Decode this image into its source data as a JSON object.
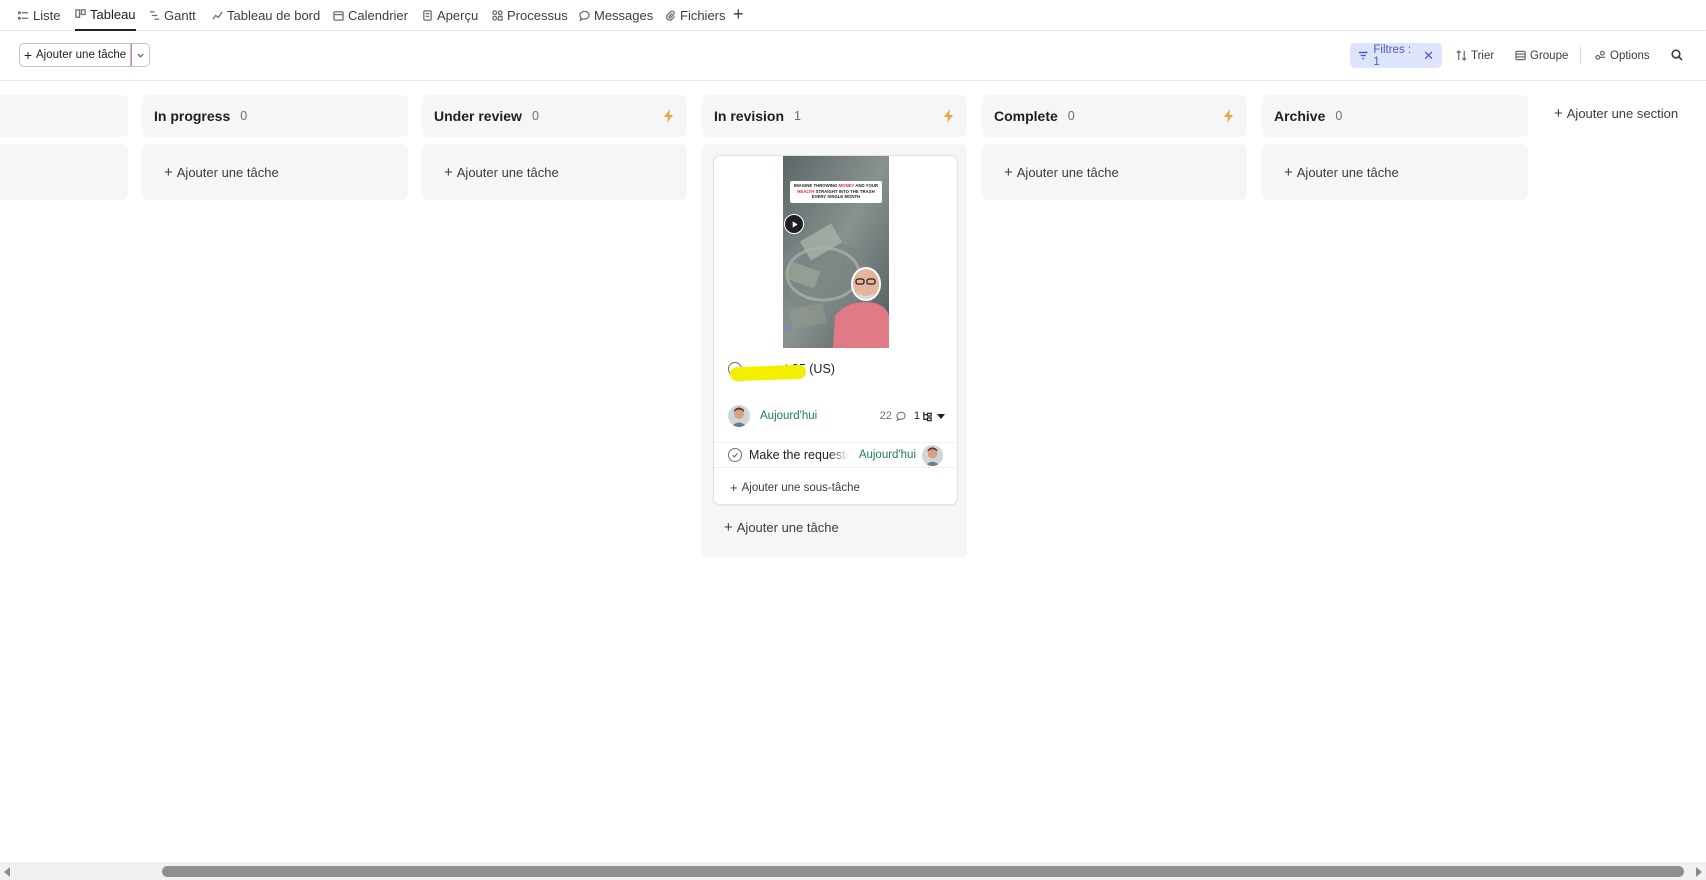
{
  "tabs": [
    {
      "label": "Liste",
      "icon": "list-icon"
    },
    {
      "label": "Tableau",
      "icon": "board-icon",
      "active": true
    },
    {
      "label": "Gantt",
      "icon": "gantt-icon"
    },
    {
      "label": "Tableau de bord",
      "icon": "dashboard-icon"
    },
    {
      "label": "Calendrier",
      "icon": "calendar-icon"
    },
    {
      "label": "Aperçu",
      "icon": "overview-icon"
    },
    {
      "label": "Processus",
      "icon": "workflow-icon"
    },
    {
      "label": "Messages",
      "icon": "message-icon"
    },
    {
      "label": "Fichiers",
      "icon": "paperclip-icon"
    }
  ],
  "toolbar": {
    "add_task_label": "Ajouter une tâche",
    "filter_label": "Filtres : 1",
    "sort_label": "Trier",
    "group_label": "Groupe",
    "options_label": "Options"
  },
  "columns": [
    {
      "name": "",
      "count": ""
    },
    {
      "name": "In progress",
      "count": "0"
    },
    {
      "name": "Under review",
      "count": "0"
    },
    {
      "name": "In revision",
      "count": "1"
    },
    {
      "name": "Complete",
      "count": "0"
    },
    {
      "name": "Archive",
      "count": "0"
    }
  ],
  "board": {
    "add_task_label": "Ajouter une tâche",
    "add_section_label": "Ajouter une section"
  },
  "card": {
    "thumbnail_caption": {
      "line1_a": "IMAGINE THROWING ",
      "line1_b": "MONEY",
      "line1_c": " AND YOUR",
      "line2_a": "HEALTH",
      "line2_b": " STRAIGHT INTO THE TRASH",
      "line3": "EVERY SINGLE MONTH"
    },
    "title": "ot 35 (US)",
    "due": "Aujourd'hui",
    "comment_count": "22",
    "subtask_count": "1",
    "subtask": {
      "name": "Make the requested",
      "due": "Aujourd'hui"
    },
    "add_subtask_label": "Ajouter une sous-tâche"
  },
  "colors": {
    "accent_filter": "#4a59c7",
    "due_green": "#1e7f4f",
    "bolt": "#f1a33a",
    "redaction": "#f3ef00"
  }
}
